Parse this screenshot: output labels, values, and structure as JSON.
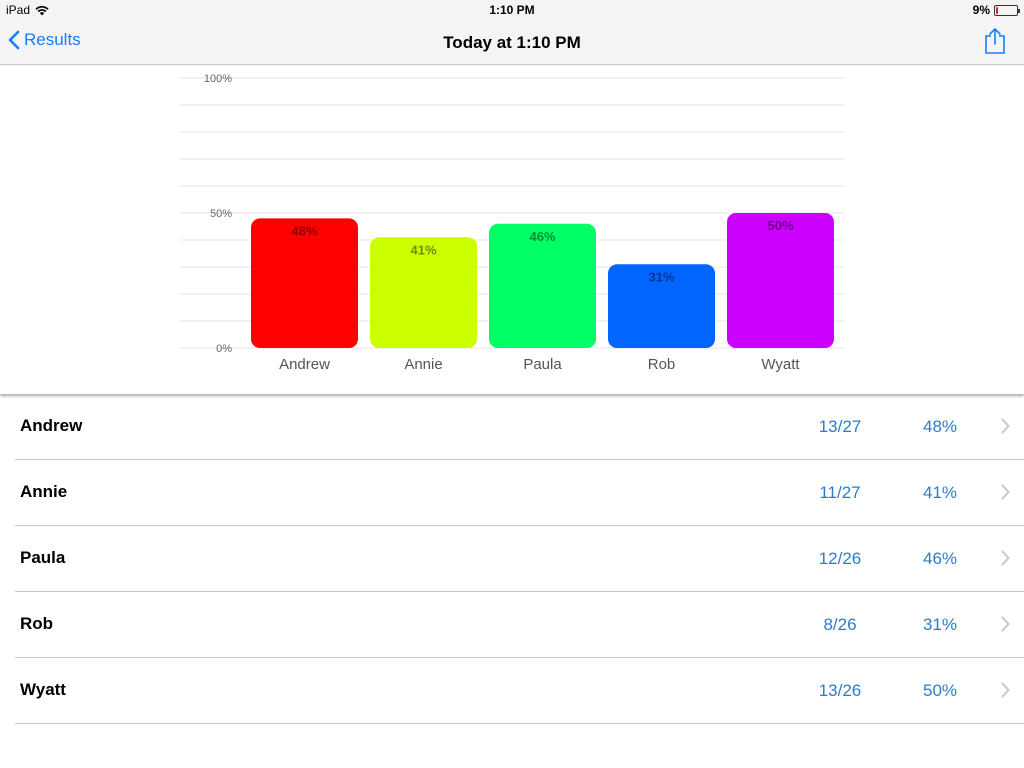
{
  "status_bar": {
    "device": "iPad",
    "time": "1:10 PM",
    "battery": "9%",
    "battery_level": 0.09,
    "battery_color": "#e0201c"
  },
  "nav": {
    "back_label": "Results",
    "title": "Today at 1:10 PM",
    "accent": "#147efb",
    "share_icon": "share-icon"
  },
  "chart_data": {
    "type": "bar",
    "categories": [
      "Andrew",
      "Annie",
      "Paula",
      "Rob",
      "Wyatt"
    ],
    "values": [
      48,
      41,
      46,
      31,
      50
    ],
    "data_labels": [
      "48%",
      "41%",
      "46%",
      "31%",
      "50%"
    ],
    "colors": [
      "#ff0000",
      "#ccff00",
      "#00ff66",
      "#0066ff",
      "#cc00ff"
    ],
    "ylim": [
      0,
      100
    ],
    "yticks": [
      0,
      50,
      100
    ],
    "ytick_labels": [
      "0%",
      "50%",
      "100%"
    ],
    "grid": true,
    "title": "",
    "xlabel": "",
    "ylabel": ""
  },
  "table": {
    "rows": [
      {
        "name": "Andrew",
        "score": "13/27",
        "percent": "48%"
      },
      {
        "name": "Annie",
        "score": "11/27",
        "percent": "41%"
      },
      {
        "name": "Paula",
        "score": "12/26",
        "percent": "46%"
      },
      {
        "name": "Rob",
        "score": "8/26",
        "percent": "31%"
      },
      {
        "name": "Wyatt",
        "score": "13/26",
        "percent": "50%"
      }
    ],
    "value_color": "#2d7cc9"
  }
}
